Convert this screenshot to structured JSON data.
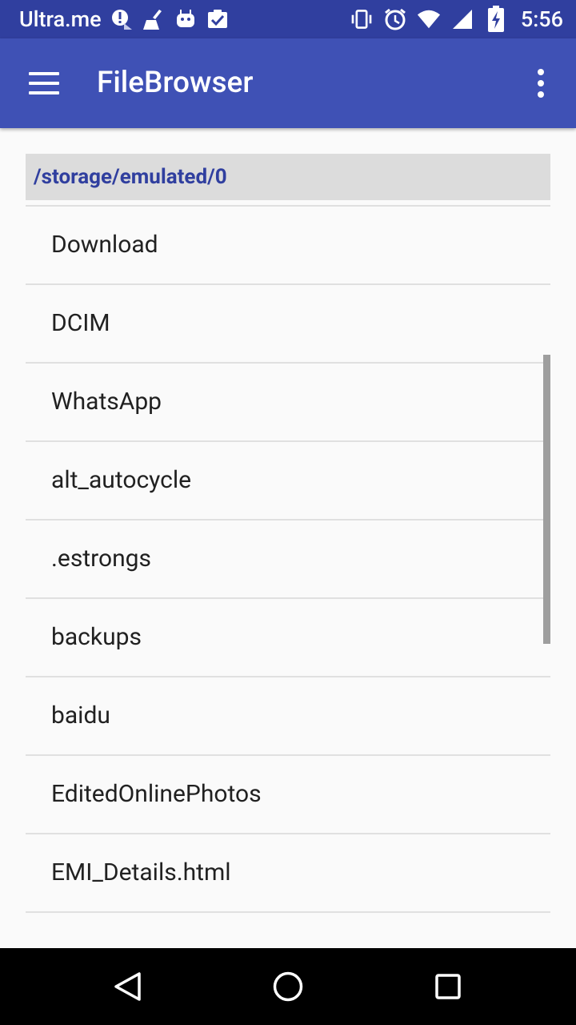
{
  "status_bar": {
    "carrier": "Ultra.me",
    "time": "5:56",
    "left_icons": [
      "alert-icon",
      "broom-icon",
      "android-icon",
      "clipboard-check-icon"
    ],
    "right_icons": [
      "vibrate-icon",
      "alarm-icon",
      "wifi-icon",
      "signal-icon",
      "battery-charging-icon"
    ]
  },
  "app_bar": {
    "title": "FileBrowser"
  },
  "path": "/storage/emulated/0",
  "files": [
    {
      "name": "Download"
    },
    {
      "name": "DCIM"
    },
    {
      "name": "WhatsApp"
    },
    {
      "name": "alt_autocycle"
    },
    {
      "name": ".estrongs"
    },
    {
      "name": "backups"
    },
    {
      "name": "baidu"
    },
    {
      "name": "EditedOnlinePhotos"
    },
    {
      "name": "EMI_Details.html"
    }
  ],
  "colors": {
    "app_bar": "#3f51b5",
    "status_bar": "#303f9f",
    "path_text": "#303f9f",
    "path_bg": "#dcdcdc"
  }
}
